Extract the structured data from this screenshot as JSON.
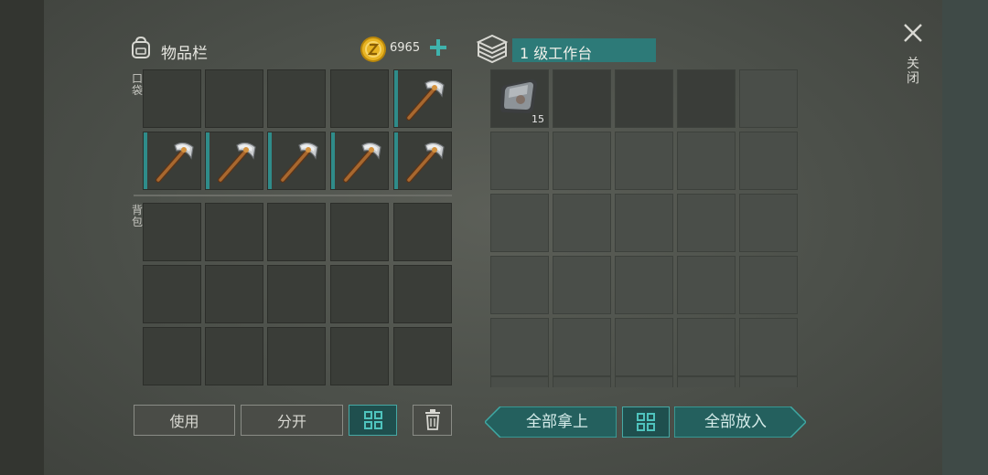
{
  "inventory": {
    "title": "物品栏",
    "coins": "6965",
    "pocket_label": "口袋",
    "backpack_label": "背包"
  },
  "workbench": {
    "title": "1 级工作台",
    "item_count": "15"
  },
  "close": {
    "label": "关闭"
  },
  "buttons": {
    "use": "使用",
    "split": "分开",
    "take_all": "全部拿上",
    "put_all": "全部放入"
  },
  "colors": {
    "accent": "#2f8c8a",
    "coin": "#e8b423"
  },
  "icons": {
    "bag": "backpack-icon",
    "coin": "coin-icon",
    "add": "plus-icon",
    "workbench": "workbench-icon",
    "close": "close-icon",
    "tool": "pickaxe-icon",
    "resource": "metal-plate-icon",
    "grid": "grid-icon",
    "trash": "trash-icon"
  }
}
